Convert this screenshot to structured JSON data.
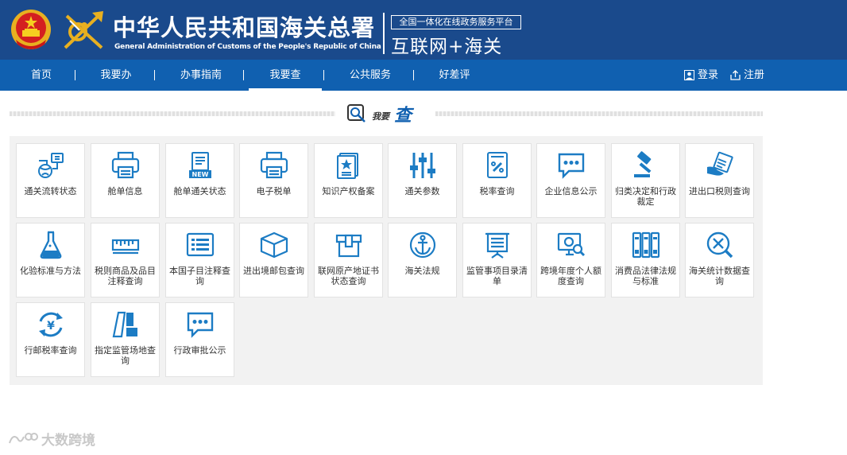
{
  "header": {
    "title_cn": "中华人民共和国海关总署",
    "title_en": "General Administration of Customs of the People's Republic of China",
    "platform_subtitle": "全国一体化在线政务服务平台",
    "platform_title": "互联网+海关"
  },
  "nav": {
    "items": [
      "首页",
      "我要办",
      "办事指南",
      "我要查",
      "公共服务",
      "好差评"
    ],
    "active": "我要查",
    "login": "登录",
    "register": "注册"
  },
  "section": {
    "prefix": "我要",
    "title": "查"
  },
  "tiles": [
    {
      "label": "通关流转状态",
      "icon": "flow-status-icon"
    },
    {
      "label": "舱单信息",
      "icon": "printer-icon"
    },
    {
      "label": "舱单通关状态",
      "icon": "new-document-icon"
    },
    {
      "label": "电子税单",
      "icon": "printer-icon"
    },
    {
      "label": "知识产权备案",
      "icon": "certificate-star-icon"
    },
    {
      "label": "通关参数",
      "icon": "sliders-icon"
    },
    {
      "label": "税率查询",
      "icon": "tax-rate-icon"
    },
    {
      "label": "企业信息公示",
      "icon": "chat-bubble-icon"
    },
    {
      "label": "归类决定和行政裁定",
      "icon": "gavel-icon"
    },
    {
      "label": "进出口税则查询",
      "icon": "hand-document-icon"
    },
    {
      "label": "化验标准与方法",
      "icon": "flask-icon"
    },
    {
      "label": "税则商品及品目注释查询",
      "icon": "ruler-icon"
    },
    {
      "label": "本国子目注释查询",
      "icon": "list-card-icon"
    },
    {
      "label": "进出境邮包查询",
      "icon": "parcel-box-icon"
    },
    {
      "label": "联网原产地证书状态查询",
      "icon": "certificate-box-icon"
    },
    {
      "label": "海关法规",
      "icon": "anchor-icon"
    },
    {
      "label": "监管事项目录清单",
      "icon": "board-list-icon"
    },
    {
      "label": "跨境年度个人额度查询",
      "icon": "monitor-search-icon"
    },
    {
      "label": "消费品法律法规与标准",
      "icon": "binders-icon"
    },
    {
      "label": "海关统计数据查询",
      "icon": "search-tools-icon"
    },
    {
      "label": "行邮税率查询",
      "icon": "yuan-cycle-icon"
    },
    {
      "label": "指定监管场地查询",
      "icon": "venue-icon"
    },
    {
      "label": "行政审批公示",
      "icon": "chat-bubble-icon"
    }
  ],
  "watermark": "大数跨境",
  "colors": {
    "header": "#1a4a8c",
    "nav": "#1060b0",
    "icon": "#1c7cc4",
    "panel": "#f2f2f2"
  }
}
